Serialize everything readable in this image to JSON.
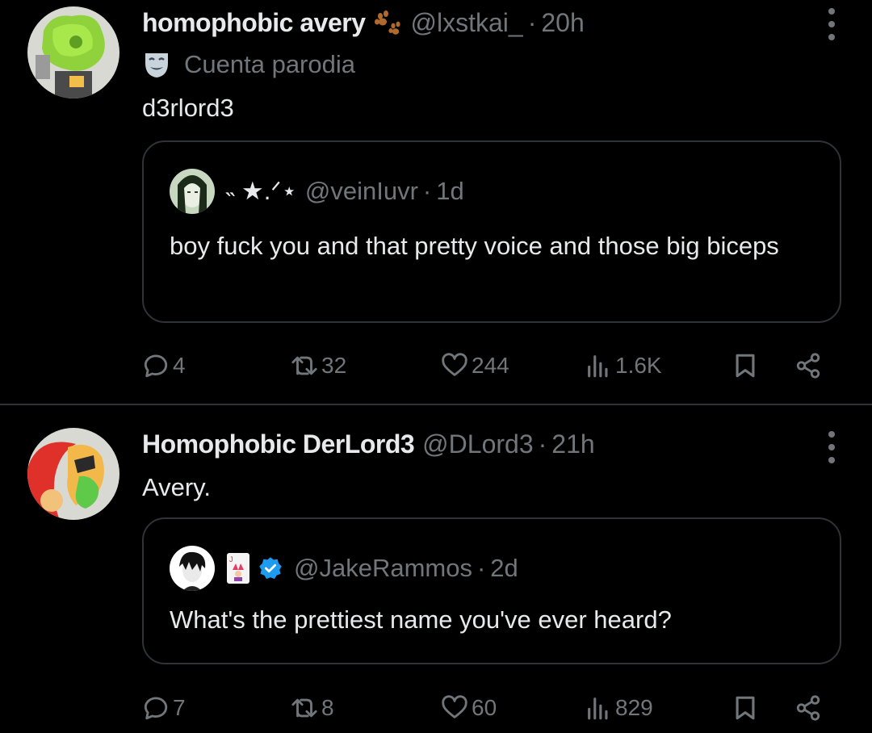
{
  "tweets": [
    {
      "author_name": "homophobic avery",
      "author_handle": "@lxstkai_",
      "separator": "·",
      "time": "20h",
      "badge_icon": "paw-prints-icon",
      "parody_label": "Cuenta parodia",
      "parody_icon": "theater-mask-icon",
      "text": "d3rlord3",
      "quote": {
        "name": "˵ ★.ᐟ⋆",
        "handle": "@veinIuvr",
        "separator": "·",
        "time": "1d",
        "text": "boy fuck you and that pretty voice and those big biceps"
      },
      "actions": {
        "replies": "4",
        "reposts": "32",
        "likes": "244",
        "views": "1.6K"
      }
    },
    {
      "author_name": "Homophobic DerLord3",
      "author_handle": "@DLord3",
      "separator": "·",
      "time": "21h",
      "text": "Avery.",
      "quote": {
        "name_icons": [
          "joker-card-icon",
          "verified-badge-icon"
        ],
        "handle": "@JakeRammos",
        "separator": "·",
        "time": "2d",
        "text": "What's the prettiest name you've ever heard?"
      },
      "actions": {
        "replies": "7",
        "reposts": "8",
        "likes": "60",
        "views": "829"
      }
    }
  ],
  "colors": {
    "background": "#000000",
    "text": "#e7e9ea",
    "muted": "#71767b",
    "border": "#2f3336",
    "verified": "#1d9bf0"
  }
}
